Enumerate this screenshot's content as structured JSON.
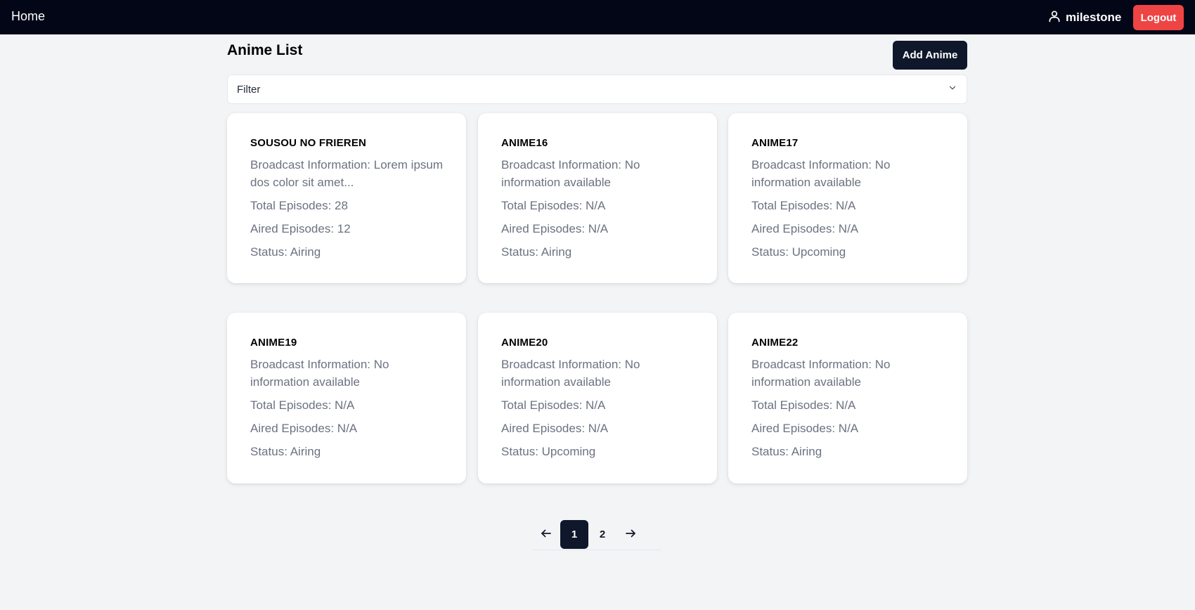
{
  "topbar": {
    "home_label": "Home",
    "username": "milestone",
    "logout_label": "Logout"
  },
  "main": {
    "title": "Anime List",
    "add_button_label": "Add Anime",
    "filter_label": "Filter"
  },
  "cards": [
    {
      "title": "SOUSOU NO FRIEREN",
      "broadcast": "Broadcast Information: Lorem ipsum dos color sit amet...",
      "total": "Total Episodes: 28",
      "aired": "Aired Episodes: 12",
      "status": "Status: Airing"
    },
    {
      "title": "ANIME16",
      "broadcast": "Broadcast Information: No information available",
      "total": "Total Episodes: N/A",
      "aired": "Aired Episodes: N/A",
      "status": "Status: Airing"
    },
    {
      "title": "ANIME17",
      "broadcast": "Broadcast Information: No information available",
      "total": "Total Episodes: N/A",
      "aired": "Aired Episodes: N/A",
      "status": "Status: Upcoming"
    },
    {
      "title": "ANIME19",
      "broadcast": "Broadcast Information: No information available",
      "total": "Total Episodes: N/A",
      "aired": "Aired Episodes: N/A",
      "status": "Status: Airing"
    },
    {
      "title": "ANIME20",
      "broadcast": "Broadcast Information: No information available",
      "total": "Total Episodes: N/A",
      "aired": "Aired Episodes: N/A",
      "status": "Status: Upcoming"
    },
    {
      "title": "ANIME22",
      "broadcast": "Broadcast Information: No information available",
      "total": "Total Episodes: N/A",
      "aired": "Aired Episodes: N/A",
      "status": "Status: Airing"
    }
  ],
  "pagination": {
    "pages": [
      "1",
      "2"
    ],
    "current": "1"
  },
  "icons": {
    "user": "user-icon",
    "chevron": "chevron-down-icon",
    "prev": "arrow-left-icon",
    "next": "arrow-right-icon"
  },
  "colors": {
    "nav_bg": "#020617",
    "logout_bg": "#ef4444",
    "primary_dark": "#0f172a",
    "page_bg": "#f3f4f6"
  }
}
